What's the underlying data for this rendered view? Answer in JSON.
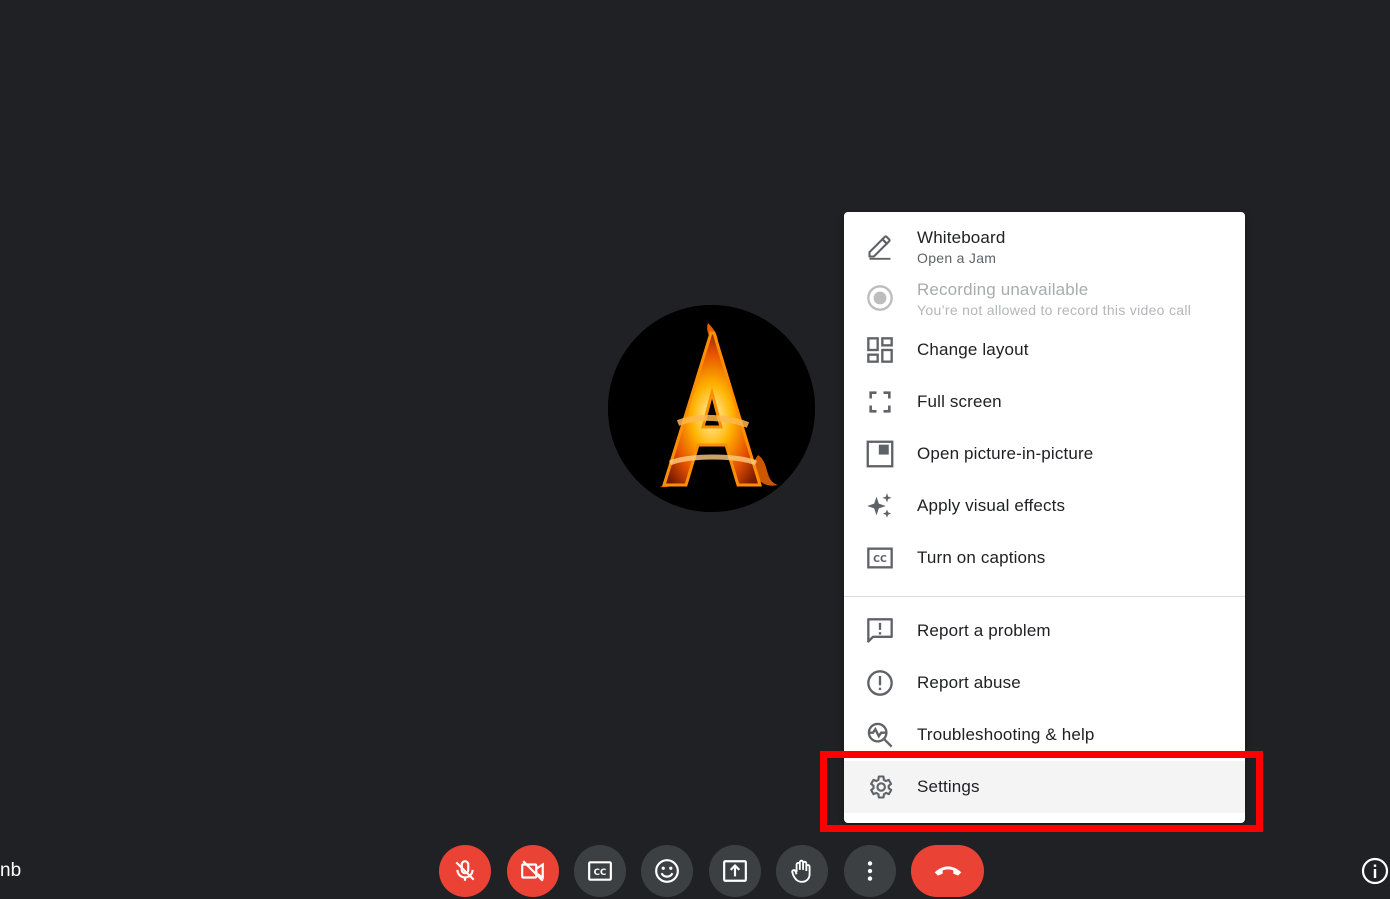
{
  "participant": {
    "name_partial": "nb"
  },
  "menu": {
    "items": [
      {
        "label": "Whiteboard",
        "sub": "Open a Jam",
        "icon": "pen-icon",
        "disabled": false
      },
      {
        "label": "Recording unavailable",
        "sub": "You’re not allowed to record this video call",
        "icon": "record-icon",
        "disabled": true
      },
      {
        "label": "Change layout",
        "icon": "layout-icon",
        "disabled": false
      },
      {
        "label": "Full screen",
        "icon": "fullscreen-icon",
        "disabled": false
      },
      {
        "label": "Open picture-in-picture",
        "icon": "pip-icon",
        "disabled": false
      },
      {
        "label": "Apply visual effects",
        "icon": "sparkle-icon",
        "disabled": false
      },
      {
        "label": "Turn on captions",
        "icon": "captions-icon",
        "disabled": false
      },
      {
        "label": "Report a problem",
        "icon": "feedback-icon",
        "disabled": false
      },
      {
        "label": "Report abuse",
        "icon": "alert-circle-icon",
        "disabled": false
      },
      {
        "label": "Troubleshooting & help",
        "icon": "troubleshoot-icon",
        "disabled": false
      },
      {
        "label": "Settings",
        "icon": "gear-icon",
        "disabled": false,
        "highlighted": true
      }
    ]
  },
  "controls": [
    {
      "name": "mic-toggle",
      "icon": "mic-off-icon",
      "state": "off"
    },
    {
      "name": "camera-toggle",
      "icon": "camera-off-icon",
      "state": "off"
    },
    {
      "name": "captions",
      "icon": "cc-icon"
    },
    {
      "name": "reactions",
      "icon": "emoji-icon"
    },
    {
      "name": "present",
      "icon": "present-icon"
    },
    {
      "name": "raise-hand",
      "icon": "hand-icon"
    },
    {
      "name": "more-options",
      "icon": "more-vert-icon"
    },
    {
      "name": "leave-call",
      "icon": "hang-up-icon"
    }
  ],
  "colors": {
    "background": "#202124",
    "danger": "#ea4335",
    "control": "#3c4043",
    "annotation": "#ff0000"
  }
}
